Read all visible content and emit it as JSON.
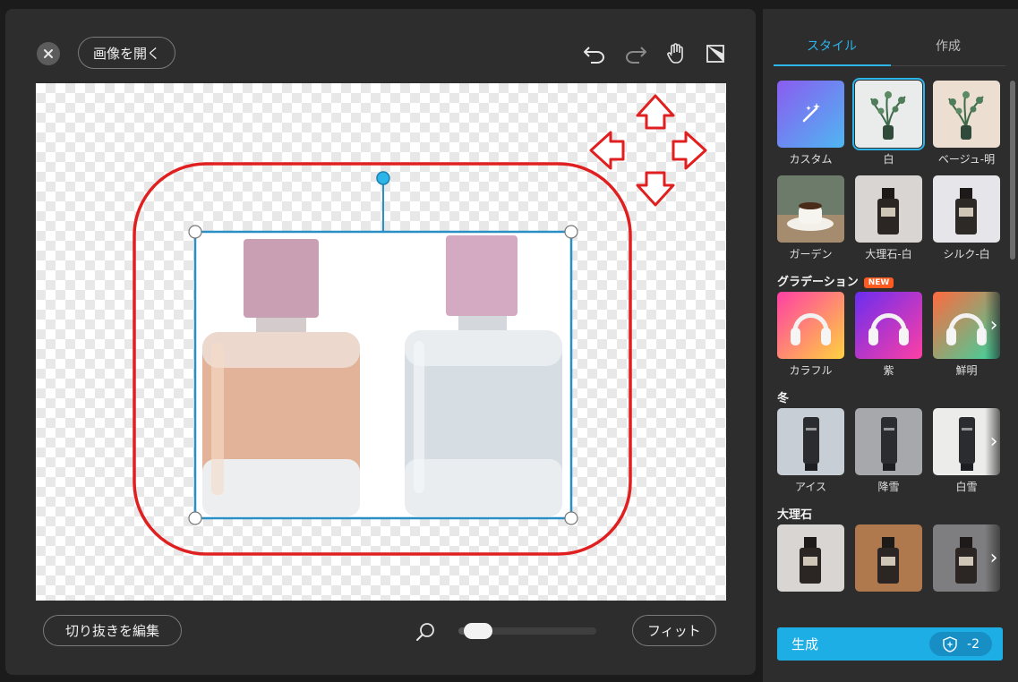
{
  "colors": {
    "accent": "#1eaee6",
    "annotation_red": "#e02020",
    "selection_blue": "#2a8fc4"
  },
  "editor": {
    "open_image_label": "画像を開く",
    "edit_cutout_label": "切り抜きを編集",
    "fit_label": "フィット",
    "zoom_level": 0.05,
    "toolbar_icons": [
      "undo-icon",
      "redo-icon",
      "hand-pan-icon",
      "compare-icon"
    ]
  },
  "side": {
    "tabs": [
      {
        "label": "スタイル",
        "active": true
      },
      {
        "label": "作成",
        "active": false
      }
    ],
    "sections": [
      {
        "title": "",
        "rows": [
          [
            {
              "label": "カスタム",
              "kind": "custom"
            },
            {
              "label": "白",
              "kind": "plant-white",
              "selected": true
            },
            {
              "label": "ベージュ-明",
              "kind": "plant-beige"
            }
          ],
          [
            {
              "label": "ガーデン",
              "kind": "coffee"
            },
            {
              "label": "大理石-白",
              "kind": "bottle-marble"
            },
            {
              "label": "シルク-白",
              "kind": "bottle-silk"
            }
          ]
        ]
      },
      {
        "title": "グラデーション",
        "badge": "NEW",
        "rows": [
          [
            {
              "label": "カラフル",
              "kind": "headphone-colorful"
            },
            {
              "label": "紫",
              "kind": "headphone-purple"
            },
            {
              "label": "鮮明",
              "kind": "headphone-vivid"
            }
          ]
        ]
      },
      {
        "title": "冬",
        "rows": [
          [
            {
              "label": "アイス",
              "kind": "tube-ice"
            },
            {
              "label": "降雪",
              "kind": "tube-snow"
            },
            {
              "label": "白雪",
              "kind": "tube-white"
            }
          ]
        ]
      },
      {
        "title": "大理石",
        "rows": [
          [
            {
              "label": "",
              "kind": "bottle-marble"
            },
            {
              "label": "",
              "kind": "bottle-brown"
            },
            {
              "label": "",
              "kind": "bottle-dark"
            }
          ]
        ]
      }
    ],
    "generate": {
      "label": "生成",
      "credit": "-2"
    }
  }
}
